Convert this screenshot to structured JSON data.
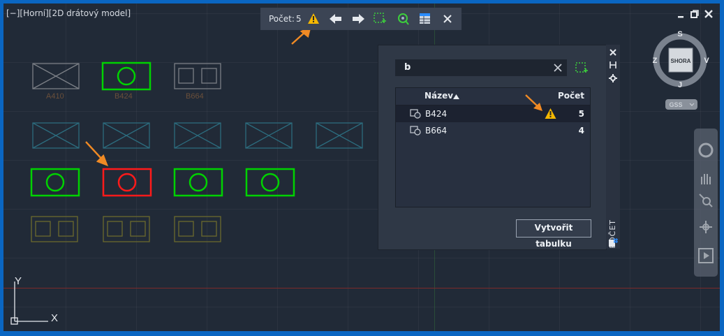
{
  "viewport": {
    "label": "[−][Horní][2D drátový model]",
    "ucs": {
      "y_label": "Y",
      "x_label": "X"
    }
  },
  "toolbar": {
    "label": "Počet:",
    "count": "5"
  },
  "blocks": {
    "label_a410": "A410",
    "label_b424": "B424",
    "label_b664": "B664"
  },
  "viewcube": {
    "face": "SHORA",
    "north": "S",
    "south": "J",
    "east": "V",
    "west": "Z",
    "ucs_menu": "GSS"
  },
  "panel": {
    "search_value": "b",
    "columns": {
      "name": "Název",
      "count": "Počet"
    },
    "rows": [
      {
        "name": "B424",
        "count": "5",
        "warning": true
      },
      {
        "name": "B664",
        "count": "4",
        "warning": false
      }
    ],
    "create_table_button": "Vytvořit tabulku",
    "title": "POČET"
  },
  "colors": {
    "accent": "#0a66c2",
    "green": "#00d200",
    "red": "#ff1a1a",
    "warning": "#f5b800",
    "annotation_arrow": "#f08a24"
  }
}
